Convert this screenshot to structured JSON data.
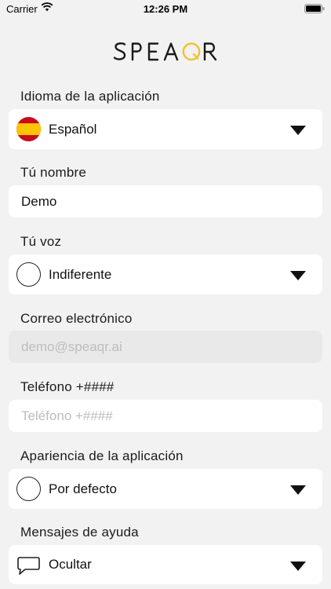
{
  "status_bar": {
    "carrier": "Carrier",
    "time": "12:26 PM"
  },
  "logo": {
    "text": "SPEAQR",
    "accent_color": "#f3c12d"
  },
  "form": {
    "language": {
      "label": "Idioma de la aplicación",
      "value": "Español",
      "icon": "spain-flag-icon"
    },
    "name": {
      "label": "Tú nombre",
      "value": "Demo"
    },
    "voice": {
      "label": "Tú voz",
      "value": "Indiferente",
      "icon": "circle-icon"
    },
    "email": {
      "label": "Correo electrónico",
      "placeholder": "demo@speaqr.ai"
    },
    "phone": {
      "label": "Teléfono +####",
      "placeholder": "Teléfono +####"
    },
    "appearance": {
      "label": "Apariencia de la aplicación",
      "value": "Por defecto",
      "icon": "circle-icon"
    },
    "help": {
      "label": "Mensajes de ayuda",
      "value": "Ocultar",
      "icon": "speech-bubble-icon"
    }
  }
}
